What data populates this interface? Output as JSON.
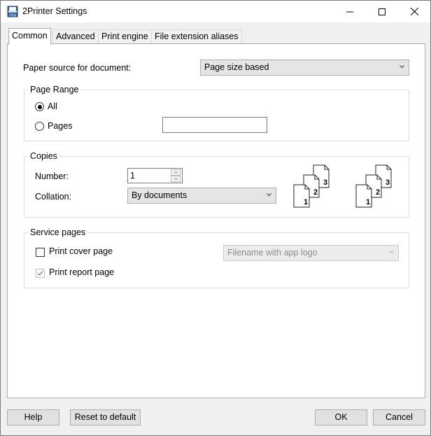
{
  "window": {
    "title": "2Printer Settings",
    "icon": "printer-app-icon"
  },
  "tabs": [
    {
      "label": "Common",
      "active": true
    },
    {
      "label": "Advanced",
      "active": false
    },
    {
      "label": "Print engine",
      "active": false
    },
    {
      "label": "File extension aliases",
      "active": false
    }
  ],
  "paper_source": {
    "label": "Paper source for document:",
    "value": "Page size based"
  },
  "page_range": {
    "title": "Page Range",
    "all_label": "All",
    "pages_label": "Pages",
    "pages_value": "",
    "selected": "All"
  },
  "copies": {
    "title": "Copies",
    "number_label": "Number:",
    "number_value": "1",
    "collation_label": "Collation:",
    "collation_value": "By documents",
    "collate_icon_a": [
      "1",
      "2",
      "3"
    ],
    "collate_icon_b": [
      "1",
      "2",
      "3"
    ]
  },
  "service_pages": {
    "title": "Service pages",
    "cover_label": "Print cover page",
    "cover_checked": false,
    "cover_option": "Filename with app logo",
    "report_label": "Print report page",
    "report_checked": true
  },
  "buttons": {
    "help": "Help",
    "reset": "Reset to default",
    "ok": "OK",
    "cancel": "Cancel"
  }
}
